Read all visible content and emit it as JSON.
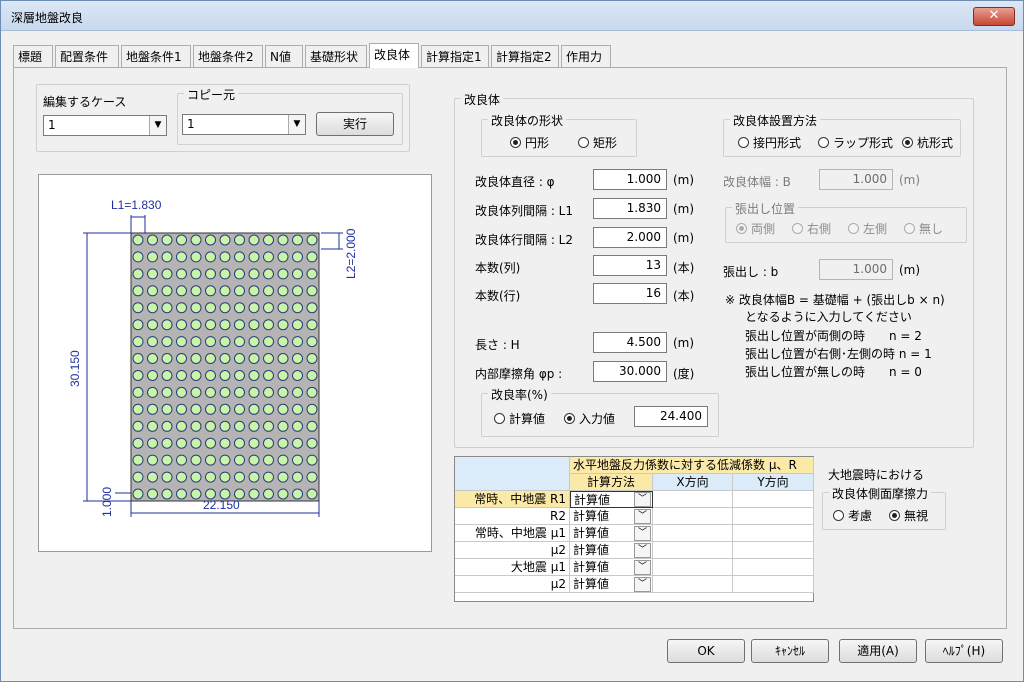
{
  "window": {
    "title": "深層地盤改良",
    "close": "✕"
  },
  "tabs": [
    "標題",
    "配置条件",
    "地盤条件1",
    "地盤条件2",
    "N値",
    "基礎形状",
    "改良体",
    "計算指定1",
    "計算指定2",
    "作用力"
  ],
  "case": {
    "label": "編集するケース",
    "value": "1"
  },
  "copy": {
    "label": "コピー元",
    "value": "1",
    "exec": "実行"
  },
  "drawing": {
    "l1": "L1=1.830",
    "l2": "L2=2.000",
    "height": "30.150",
    "width": "22.150",
    "left_offset": "1.000",
    "cols": 13,
    "rows": 16
  },
  "kairyo": {
    "group": "改良体",
    "shape": {
      "label": "改良体の形状",
      "circle": "円形",
      "rect": "矩形"
    },
    "diameter": {
      "label": "改良体直径 : φ",
      "value": "1.000",
      "unit": "(m)"
    },
    "col_spacing": {
      "label": "改良体列間隔 : L1",
      "value": "1.830",
      "unit": "(m)"
    },
    "row_spacing": {
      "label": "改良体行間隔 : L2",
      "value": "2.000",
      "unit": "(m)"
    },
    "count_col": {
      "label": "本数(列)",
      "value": "13",
      "unit": "(本)"
    },
    "count_row": {
      "label": "本数(行)",
      "value": "16",
      "unit": "(本)"
    },
    "length": {
      "label": "長さ : H",
      "value": "4.500",
      "unit": "(m)"
    },
    "friction": {
      "label": "内部摩擦角 φp :",
      "value": "30.000",
      "unit": "(度)"
    },
    "ratio": {
      "label": "改良率(%)",
      "calc": "計算値",
      "input": "入力値",
      "value": "24.400"
    },
    "method": {
      "label": "改良体設置方法",
      "opt1": "接円形式",
      "opt2": "ラップ形式",
      "opt3": "杭形式"
    },
    "width": {
      "label": "改良体幅 : B",
      "value": "1.000",
      "unit": "(m)"
    },
    "overhang_pos": {
      "label": "張出し位置",
      "opt1": "両側",
      "opt2": "右側",
      "opt3": "左側",
      "opt4": "無し"
    },
    "overhang": {
      "label": "張出し : b",
      "value": "1.000",
      "unit": "(m)"
    },
    "notes": [
      "※ 改良体幅B = 基礎幅 + (張出しb × n)",
      "となるように入力してください",
      "張出し位置が両側の時　　n = 2",
      "張出し位置が右側･左側の時 n = 1",
      "張出し位置が無しの時　　n = 0"
    ]
  },
  "table": {
    "title": "水平地盤反力係数に対する低減係数 μ、R",
    "headers": [
      "計算方法",
      "X方向",
      "Y方向"
    ],
    "rows": [
      {
        "label": "常時、中地震 R1",
        "method": "計算値"
      },
      {
        "label": "R2",
        "method": "計算値"
      },
      {
        "label": "常時、中地震 μ1",
        "method": "計算値"
      },
      {
        "label": "μ2",
        "method": "計算値"
      },
      {
        "label": "大地震 μ1",
        "method": "計算値"
      },
      {
        "label": "μ2",
        "method": "計算値"
      }
    ]
  },
  "side_friction": {
    "heading": "大地震時における",
    "label": "改良体側面摩擦力",
    "opt1": "考慮",
    "opt2": "無視"
  },
  "buttons": {
    "ok": "OK",
    "cancel": "ｷｬﾝｾﾙ",
    "apply": "適用(A)",
    "help": "ﾍﾙﾌﾟ(H)"
  }
}
